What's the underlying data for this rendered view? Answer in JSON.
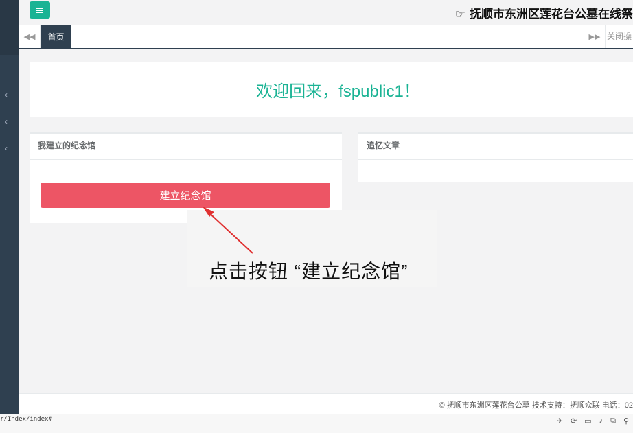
{
  "site_title": "抚顺市东洲区莲花台公墓在线祭",
  "tabs": {
    "home_label": "首页",
    "close_label": "关闭操"
  },
  "welcome": {
    "text": "欢迎回来，fspublic1！"
  },
  "panels": {
    "my_memorials": {
      "title": "我建立的纪念馆",
      "button": "建立纪念馆"
    },
    "articles": {
      "title": "追忆文章"
    }
  },
  "annotation": {
    "text": "点击按钮 “建立纪念馆”"
  },
  "footer": {
    "text": "© 抚顺市东洲区莲花台公墓   技术支持：抚顺众联 电话：02"
  },
  "statusbar": {
    "url": "r/Index/index#"
  },
  "colors": {
    "accent": "#1ab394",
    "danger": "#ed5565",
    "sidebar": "#2f4050"
  },
  "icons": [
    "menu-icon",
    "pointing-hand-icon",
    "backward-icon",
    "forward-icon",
    "chevron-left-icon"
  ]
}
